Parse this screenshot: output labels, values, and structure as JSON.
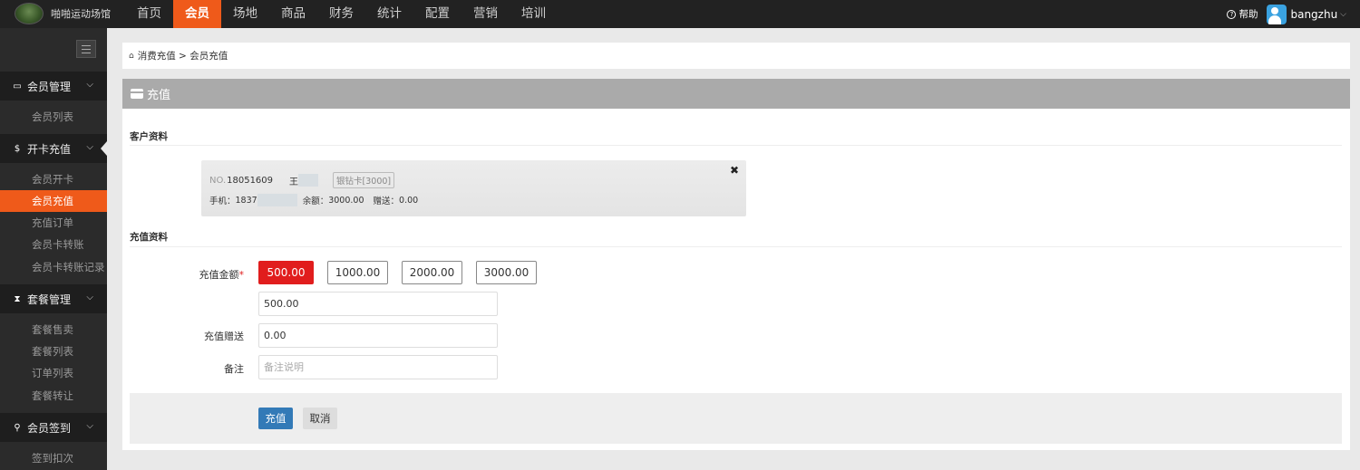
{
  "app": {
    "name": "啪啪运动场馆"
  },
  "topnav": [
    {
      "label": "首页",
      "active": false
    },
    {
      "label": "会员",
      "active": true
    },
    {
      "label": "场地",
      "active": false
    },
    {
      "label": "商品",
      "active": false
    },
    {
      "label": "财务",
      "active": false
    },
    {
      "label": "统计",
      "active": false
    },
    {
      "label": "配置",
      "active": false
    },
    {
      "label": "营销",
      "active": false
    },
    {
      "label": "培训",
      "active": false
    }
  ],
  "header_right": {
    "help_icon": "?",
    "help_label": "帮助",
    "username": "bangzhu",
    "caret": "⌵"
  },
  "sidebar": {
    "sections": [
      {
        "icon": "▭",
        "label": "会员管理",
        "items": [
          "会员列表"
        ]
      },
      {
        "icon": "$",
        "label": "开卡充值",
        "items": [
          "会员开卡",
          "会员充值",
          "充值订单",
          "会员卡转账",
          "会员卡转账记录"
        ]
      },
      {
        "icon": "⧗",
        "label": "套餐管理",
        "items": [
          "套餐售卖",
          "套餐列表",
          "订单列表",
          "套餐转让"
        ]
      },
      {
        "icon": "⚲",
        "label": "会员签到",
        "items": [
          "签到扣次"
        ]
      }
    ],
    "active_item": "会员充值",
    "chevron": "⌵"
  },
  "breadcrumb": {
    "home_icon": "⌂",
    "path": "消费充值 > 会员充值"
  },
  "panel": {
    "title": "充值"
  },
  "customer_section": {
    "label": "客户资料"
  },
  "customer": {
    "close": "✖",
    "no_label": "NO.",
    "no": "18051609",
    "name": "王",
    "card_type": "银钻卡[3000]",
    "phone_label": "手机：",
    "phone": "1837",
    "balance_label": "余额：",
    "balance": "3000.00",
    "bonus_label": "赠送：",
    "bonus": "0.00"
  },
  "recharge_section": {
    "label": "充值资料"
  },
  "form": {
    "amount_label": "充值金额",
    "required_mark": "*",
    "amount_options": [
      "500.00",
      "1000.00",
      "2000.00",
      "3000.00"
    ],
    "selected_amount": "500.00",
    "amount_value": "500.00",
    "bonus_label": "充值赠送",
    "bonus_value": "0.00",
    "remark_label": "备注",
    "remark_placeholder": "备注说明"
  },
  "actions": {
    "submit": "充值",
    "cancel": "取消"
  },
  "colors": {
    "accent": "#ef5a1a",
    "selected_amount": "#e11d1d",
    "primary_button": "#337ab7"
  }
}
